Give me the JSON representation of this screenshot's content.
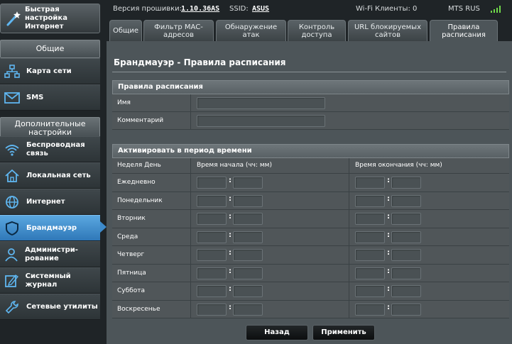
{
  "sidebar": {
    "quick_setup": "Быстрая настройка Интернет",
    "general_header": "Общие",
    "general_items": [
      {
        "label": "Карта сети",
        "icon": "network-map-icon"
      },
      {
        "label": "SMS",
        "icon": "envelope-icon"
      }
    ],
    "advanced_header": "Дополнительные настройки",
    "advanced_items": [
      {
        "label": "Беспроводная связь",
        "icon": "wifi-icon"
      },
      {
        "label": "Локальная сеть",
        "icon": "home-icon"
      },
      {
        "label": "Интернет",
        "icon": "globe-icon"
      },
      {
        "label": "Брандмауэр",
        "icon": "shield-icon"
      },
      {
        "label": "Администри-рование",
        "icon": "user-icon"
      },
      {
        "label": "Системный журнал",
        "icon": "log-icon"
      },
      {
        "label": "Сетевые утилиты",
        "icon": "wrench-icon"
      }
    ]
  },
  "topbar": {
    "firmware_label": "Версия прошивки:",
    "firmware_value": "1.10.36AS",
    "ssid_label": "SSID:",
    "ssid_value": "ASUS",
    "wifi_clients": "Wi-Fi Клиенты: 0",
    "operator": "MTS RUS"
  },
  "tabs": [
    "Общие",
    "Фильтр MAC-адресов",
    "Обнаружение атак",
    "Контроль доступа",
    "URL блокируемых сайтов",
    "Правила расписания"
  ],
  "main": {
    "title": "Брандмауэр - Правила расписания",
    "rules_header": "Правила расписания",
    "name_label": "Имя",
    "comment_label": "Комментарий",
    "period_header": "Активировать в период времени",
    "col_day": "Неделя День",
    "col_start": "Время начала (чч: мм)",
    "col_end": "Время окончания (чч: мм)",
    "days": [
      "Ежедневно",
      "Понедельник",
      "Вторник",
      "Среда",
      "Четверг",
      "Пятница",
      "Суббота",
      "Воскресенье"
    ],
    "colon": ":"
  },
  "buttons": {
    "back": "Назад",
    "apply": "Применить"
  },
  "colors": {
    "active_nav": "#3d8acb",
    "panel_bg": "#4d5559",
    "signal": "#6fd84a"
  }
}
